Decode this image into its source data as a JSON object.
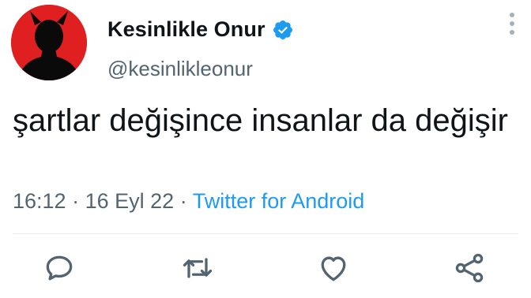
{
  "tweet": {
    "author": {
      "display_name": "Kesinlikle Onur",
      "handle": "@kesinlikleonur",
      "verified": true,
      "avatar_icon": "devil-silhouette-icon",
      "avatar_bg": "#e02020"
    },
    "text": "şartlar değişince insanlar da değişir",
    "time": "16:12",
    "date": "16 Eyl 22",
    "separator": "·",
    "source": "Twitter for Android"
  },
  "actions": {
    "reply_icon": "reply-icon",
    "retweet_icon": "retweet-icon",
    "like_icon": "heart-icon",
    "share_icon": "share-icon"
  },
  "colors": {
    "accent": "#1d9bf0",
    "secondary_text": "#536471",
    "icon_gray": "#536471"
  }
}
